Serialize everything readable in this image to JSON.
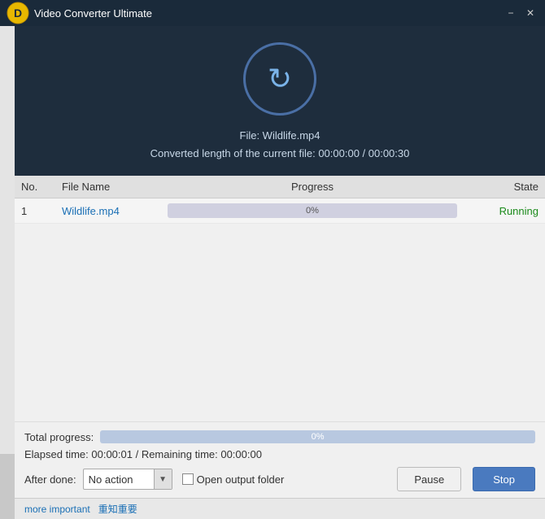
{
  "titleBar": {
    "title": "Video Converter Ultimate",
    "logoUrl": "",
    "minimizeLabel": "−",
    "closeLabel": "✕"
  },
  "convertHeader": {
    "fileName": "File: Wildlife.mp4",
    "convertedLength": "Converted length of the current file: 00:00:00 / 00:00:30"
  },
  "table": {
    "columns": {
      "no": "No.",
      "fileName": "File Name",
      "progress": "Progress",
      "state": "State"
    },
    "rows": [
      {
        "no": "1",
        "fileName": "Wildlife.mp4",
        "progressValue": 0,
        "progressLabel": "0%",
        "state": "Running"
      }
    ]
  },
  "statusSection": {
    "totalProgressLabel": "Total progress:",
    "totalProgressValue": 0,
    "totalProgressText": "0%",
    "elapsedText": "Elapsed time: 00:00:01 / Remaining time: 00:00:00"
  },
  "afterDone": {
    "label": "After done:",
    "actionValue": "No action",
    "checkboxLabel": "Open output folder"
  },
  "buttons": {
    "pause": "Pause",
    "stop": "Stop"
  },
  "bottomBar": {
    "moreText": "more important",
    "moreText2": "重知重要"
  }
}
